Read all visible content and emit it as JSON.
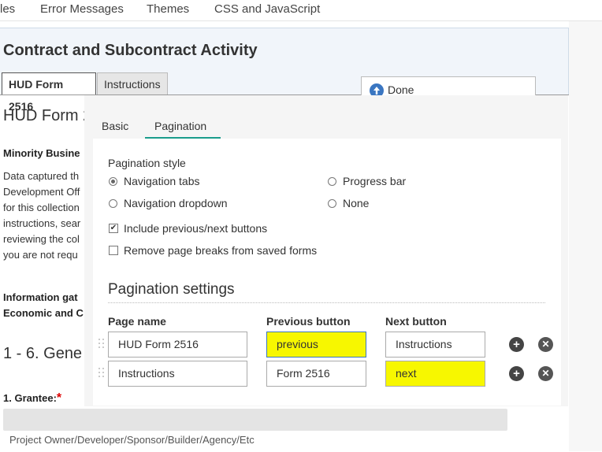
{
  "top_tabs": [
    "les",
    "Error Messages",
    "Themes",
    "CSS and JavaScript"
  ],
  "form": {
    "title": "Contract and Subcontract Activity",
    "tabs": [
      "HUD Form 2516",
      "Instructions"
    ],
    "page_heading": "HUD Form 2",
    "minority_heading": "Minority Busine",
    "paragraph_lines": [
      "Data captured th",
      "Development Off",
      "for this collection",
      "instructions, sear",
      "reviewing the col",
      "you are not requ"
    ],
    "info_lines": [
      "Information gat",
      "Economic and C"
    ],
    "section_heading": "1 - 6. Gene",
    "grantee_label": "1. Grantee:",
    "grantee_required": "*",
    "grantee_sublabel": "Project Owner/Developer/Sponsor/Builder/Agency/Etc"
  },
  "done_button": {
    "label": "Done",
    "icon": "arrow-up-circle-icon"
  },
  "panel": {
    "tabs": [
      "Basic",
      "Pagination"
    ],
    "active_tab": "Pagination",
    "pagination_style_label": "Pagination style",
    "options": {
      "navigation_tabs": "Navigation tabs",
      "navigation_dropdown": "Navigation dropdown",
      "progress_bar": "Progress bar",
      "none": "None"
    },
    "selected_style": "navigation_tabs",
    "include_prev_next": {
      "label": "Include previous/next buttons",
      "checked": true
    },
    "remove_page_breaks": {
      "label": "Remove page breaks from saved forms",
      "checked": false
    },
    "settings_title": "Pagination settings",
    "columns": [
      "Page name",
      "Previous button",
      "Next button"
    ],
    "rows": [
      {
        "page_name": "HUD Form 2516",
        "previous": "previous",
        "next": "Instructions"
      },
      {
        "page_name": "Instructions",
        "previous": "Form 2516",
        "next": "next"
      }
    ],
    "add_icon": "plus-circle-icon",
    "delete_icon": "x-circle-icon"
  },
  "colors": {
    "accent_tab": "#1a9c8c",
    "highlight": "#f7f700",
    "done_icon": "#3a76c1"
  }
}
